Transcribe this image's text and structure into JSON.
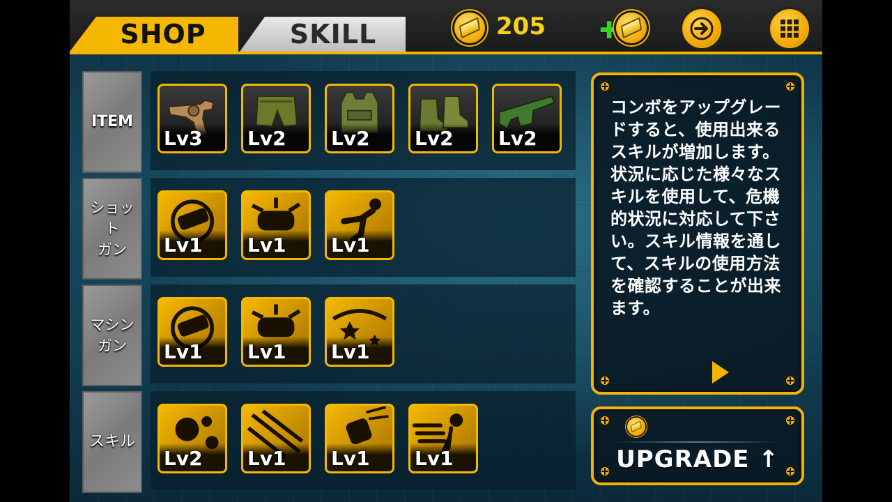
{
  "tabs": {
    "shop": "SHOP",
    "skill": "SKILL"
  },
  "gold": {
    "count": "205"
  },
  "header_buttons": {
    "add_gold_icon": "plus",
    "next_icon": "arrow-right",
    "menu_icon": "grid"
  },
  "rows": [
    {
      "label": "ITEM",
      "slots": [
        {
          "kind": "revolver",
          "level": "Lv3"
        },
        {
          "kind": "armor-pants",
          "level": "Lv2"
        },
        {
          "kind": "vest",
          "level": "Lv2"
        },
        {
          "kind": "boots",
          "level": "Lv2"
        },
        {
          "kind": "sunglasses",
          "level": "Lv2"
        }
      ]
    },
    {
      "label": "ショット\nガン",
      "slots": [
        {
          "kind": "reload-skill",
          "level": "Lv1"
        },
        {
          "kind": "blast-skill",
          "level": "Lv1"
        },
        {
          "kind": "kick-skill",
          "level": "Lv1"
        }
      ]
    },
    {
      "label": "マシン\nガン",
      "slots": [
        {
          "kind": "reload-skill",
          "level": "Lv1"
        },
        {
          "kind": "blast-skill",
          "level": "Lv1"
        },
        {
          "kind": "star-skill",
          "level": "Lv1"
        }
      ]
    },
    {
      "label": "スキル",
      "slots": [
        {
          "kind": "explosion-skill",
          "level": "Lv2"
        },
        {
          "kind": "bullet-skill",
          "level": "Lv1"
        },
        {
          "kind": "punch-skill",
          "level": "Lv1"
        },
        {
          "kind": "dash-skill",
          "level": "Lv1"
        }
      ]
    }
  ],
  "info": {
    "text": "コンボをアップグレードすると、使用出来るスキルが増加します。状況に応じた様々なスキルを使用して、危機的状況に対応して下さい。スキル情報を通して、スキルの使用方法を確認することが出来ます。"
  },
  "upgrade": {
    "label": "UPGRADE ↑"
  },
  "colors": {
    "accent": "#f2b400",
    "panel_bg": "#0b2230"
  }
}
